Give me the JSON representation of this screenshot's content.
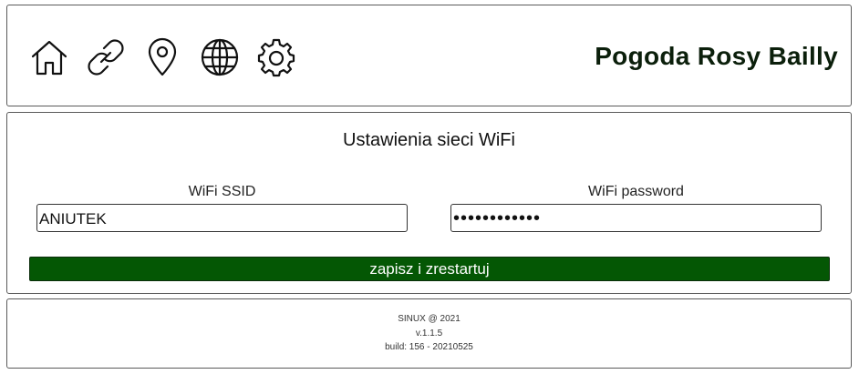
{
  "header": {
    "title": "Pogoda Rosy Bailly",
    "nav_icons": [
      "home-icon",
      "link-icon",
      "location-pin-icon",
      "globe-icon",
      "gear-icon"
    ]
  },
  "wifi_settings": {
    "title": "Ustawienia sieci WiFi",
    "ssid_label": "WiFi SSID",
    "ssid_value": "ANIUTEK",
    "password_label": "WiFi password",
    "password_value": "************",
    "submit_label": "zapisz i zrestartuj"
  },
  "footer": {
    "copyright": "SINUX @ 2021",
    "version": "v.1.1.5",
    "build": "build: 156 - 20210525"
  },
  "colors": {
    "accent": "#045704",
    "title_text": "#0b1f0b",
    "border": "#5a5a5a"
  }
}
